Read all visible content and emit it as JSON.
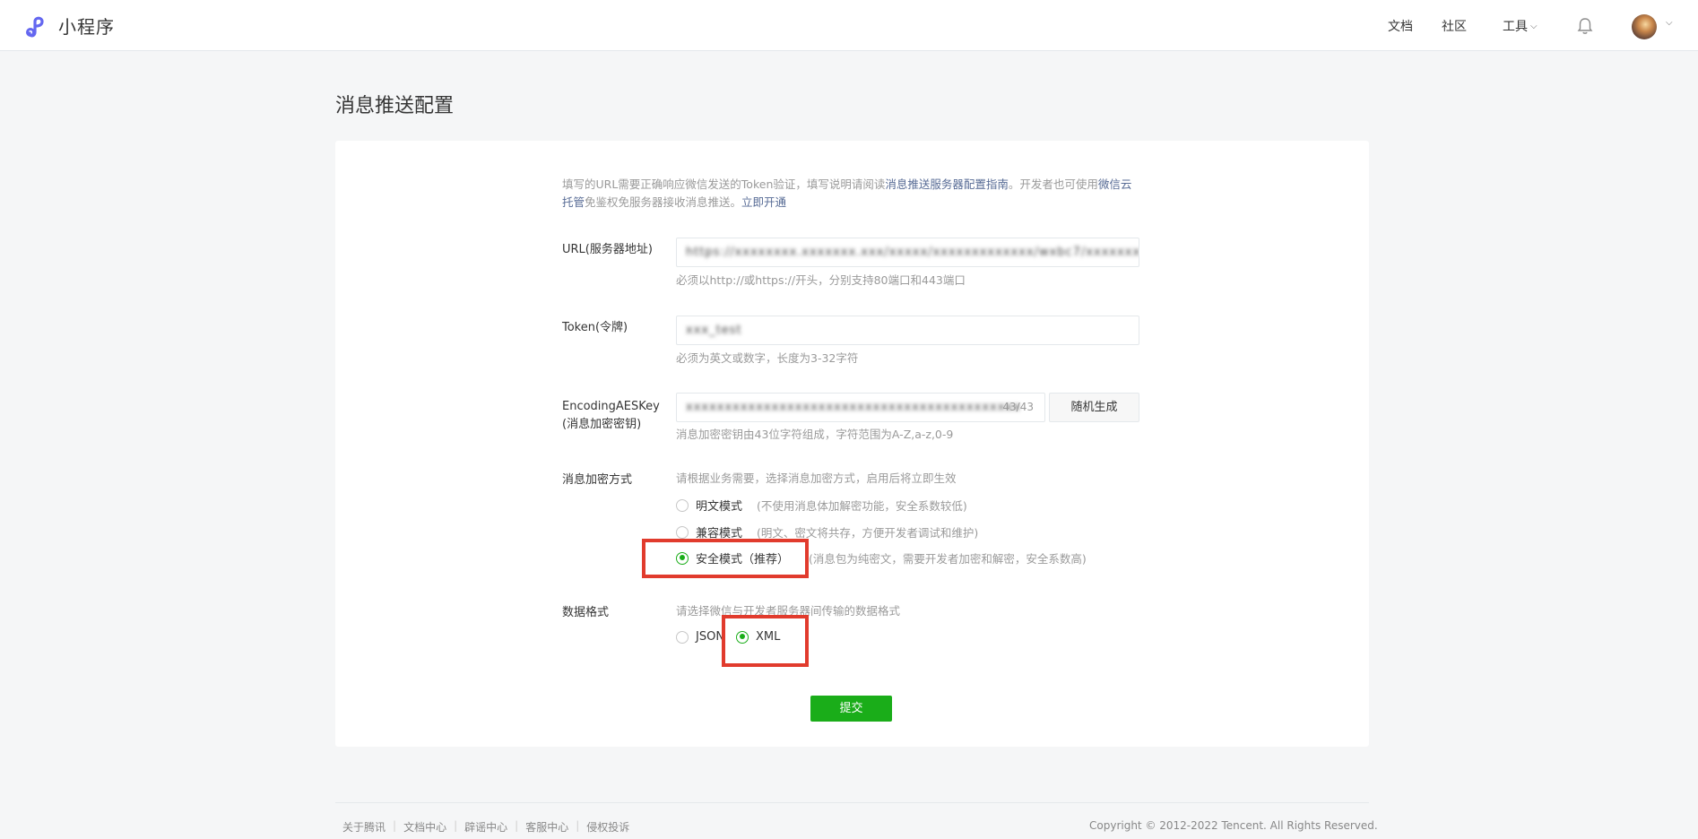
{
  "header": {
    "app_name": "小程序",
    "nav": {
      "docs": "文档",
      "community": "社区",
      "tools": "工具"
    },
    "icons": {
      "logo": "miniprogram-logo-icon",
      "bell": "bell-icon",
      "avatar": "user-avatar"
    }
  },
  "page": {
    "title": "消息推送配置"
  },
  "intro": {
    "text_before": "填写的URL需要正确响应微信发送的Token验证，填写说明请阅读",
    "link_guide": "消息推送服务器配置指南",
    "text_middle": "。开发者也可使用",
    "link_cloud": "微信云托管",
    "text_after": "免鉴权免服务器接收消息推送。",
    "link_open": "立即开通"
  },
  "form": {
    "url": {
      "label": "URL(服务器地址)",
      "value": "https://xxxxxxxx.xxxxxxx.xxx/xxxxx/xxxxxxxxxxxxx/wxbc7/xxxxxxx",
      "hint": "必须以http://或https://开头，分别支持80端口和443端口"
    },
    "token": {
      "label": "Token(令牌)",
      "value": "xxx_test",
      "hint": "必须为英文或数字，长度为3-32字符"
    },
    "aes": {
      "label_line1": "EncodingAESKey",
      "label_line2": "(消息加密密钥)",
      "value": "xxxxxxxxxxxxxxxxxxxxxxxxxxxxxxxxxxxxxxxxxxx",
      "counter": "43/43",
      "generate_button": "随机生成",
      "hint": "消息加密密钥由43位字符组成，字符范围为A-Z,a-z,0-9"
    },
    "encryption": {
      "label": "消息加密方式",
      "hint": "请根据业务需要，选择消息加密方式，启用后将立即生效",
      "options": [
        {
          "label": "明文模式",
          "desc": "(不使用消息体加解密功能，安全系数较低)",
          "selected": false
        },
        {
          "label": "兼容模式",
          "desc": "(明文、密文将共存，方便开发者调试和维护)",
          "selected": false
        },
        {
          "label": "安全模式（推荐）",
          "desc": "(消息包为纯密文，需要开发者加密和解密，安全系数高)",
          "selected": true
        }
      ]
    },
    "format": {
      "label": "数据格式",
      "hint": "请选择微信与开发者服务器间传输的数据格式",
      "options": [
        {
          "label": "JSON",
          "selected": false
        },
        {
          "label": "XML",
          "selected": true
        }
      ]
    },
    "submit": "提交"
  },
  "footer": {
    "links": [
      "关于腾讯",
      "文档中心",
      "辟谣中心",
      "客服中心",
      "侵权投诉"
    ],
    "copyright": "Copyright © 2012-2022 Tencent. All Rights Reserved."
  },
  "colors": {
    "accent": "#1aad19",
    "link": "#576b95",
    "highlight": "#e13b2d"
  }
}
